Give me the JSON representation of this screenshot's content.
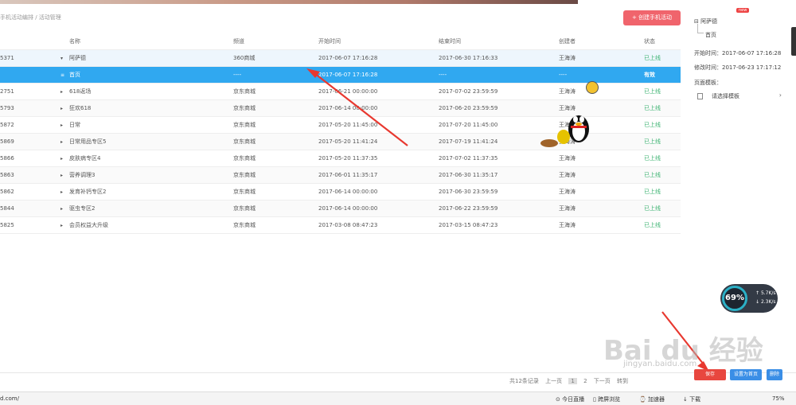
{
  "breadcrumb": "手机活动编排 / 活动管理",
  "create_button": "+ 创建手机活动",
  "table": {
    "headers": {
      "name": "名称",
      "channel": "频道",
      "start": "开始时间",
      "end": "结束时间",
      "creator": "创建者",
      "status": "状态"
    },
    "rows": [
      {
        "id": "5371",
        "name": "阿萨德",
        "channel": "360商城",
        "start": "2017-06-07 17:16:28",
        "end": "2017-06-30 17:16:33",
        "creator": "王海涛",
        "status": "已上线",
        "style": "hl",
        "caret": "▾"
      },
      {
        "id": "",
        "name": "首页",
        "channel": "----",
        "start": "2017-06-07 17:16:28",
        "end": "----",
        "creator": "----",
        "status": "有效",
        "style": "sel",
        "caret": "≡"
      },
      {
        "id": "2751",
        "name": "618返场",
        "channel": "京东商城",
        "start": "2017-06-21 00:00:00",
        "end": "2017-07-02 23:59:59",
        "creator": "王海涛",
        "status": "已上线",
        "style": "",
        "caret": "▸"
      },
      {
        "id": "5793",
        "name": "狂欢618",
        "channel": "京东商城",
        "start": "2017-06-14 00:00:00",
        "end": "2017-06-20 23:59:59",
        "creator": "王海涛",
        "status": "已上线",
        "style": "alt",
        "caret": "▸"
      },
      {
        "id": "5872",
        "name": "日常",
        "channel": "京东商城",
        "start": "2017-05-20 11:45:00",
        "end": "2017-07-20 11:45:00",
        "creator": "王海涛",
        "status": "已上线",
        "style": "",
        "caret": "▸"
      },
      {
        "id": "5869",
        "name": "日常用品专区5",
        "channel": "京东商城",
        "start": "2017-05-20 11:41:24",
        "end": "2017-07-19 11:41:24",
        "creator": "王海涛",
        "status": "已上线",
        "style": "alt",
        "caret": "▸"
      },
      {
        "id": "5866",
        "name": "皮肤病专区4",
        "channel": "京东商城",
        "start": "2017-05-20 11:37:35",
        "end": "2017-07-02 11:37:35",
        "creator": "王海涛",
        "status": "已上线",
        "style": "",
        "caret": "▸"
      },
      {
        "id": "5863",
        "name": "营养调理3",
        "channel": "京东商城",
        "start": "2017-06-01 11:35:17",
        "end": "2017-06-30 11:35:17",
        "creator": "王海涛",
        "status": "已上线",
        "style": "alt",
        "caret": "▸"
      },
      {
        "id": "5862",
        "name": "发育补钙专区2",
        "channel": "京东商城",
        "start": "2017-06-14 00:00:00",
        "end": "2017-06-30 23:59:59",
        "creator": "王海涛",
        "status": "已上线",
        "style": "",
        "caret": "▸"
      },
      {
        "id": "5844",
        "name": "驱虫专区2",
        "channel": "京东商城",
        "start": "2017-06-14 00:00:00",
        "end": "2017-06-22 23:59:59",
        "creator": "王海涛",
        "status": "已上线",
        "style": "alt",
        "caret": "▸"
      },
      {
        "id": "5825",
        "name": "会员权益大升级",
        "channel": "京东商城",
        "start": "2017-03-08 08:47:23",
        "end": "2017-03-15 08:47:23",
        "creator": "王海涛",
        "status": "已上线",
        "style": "",
        "caret": "▸"
      }
    ]
  },
  "side": {
    "badge": "new",
    "tree_root": "阿萨德",
    "tree_child": "首页",
    "start_time": "开始时间：2017-06-07 17:16:28",
    "modify_time": "修改时间：2017-06-23 17:17:12",
    "template_label": "页面模板：",
    "template_select": "请选择模板",
    "template_arrow": "›"
  },
  "pager": {
    "total": "共12条记录",
    "prev": "上一页",
    "page1": "1",
    "page2": "2",
    "next": "下一页",
    "jump": "转到"
  },
  "footer_buttons": {
    "save": "保存",
    "set_home": "设置为首页",
    "delete": "删除"
  },
  "status_bar": {
    "url": "d.com/",
    "items": [
      "今日直播",
      "跨屏浏览",
      "加速器",
      "下载",
      "75%"
    ]
  },
  "speed_widget": {
    "percent": "69%",
    "up": "5.7K/s",
    "down": "2.3K/s"
  },
  "watermark": {
    "main": "Bai du 经验",
    "sub": "jingyan.baidu.com"
  },
  "colors": {
    "accent_blue": "#30a8f0",
    "create_red": "#f0646c",
    "status_green": "#3cb371"
  }
}
